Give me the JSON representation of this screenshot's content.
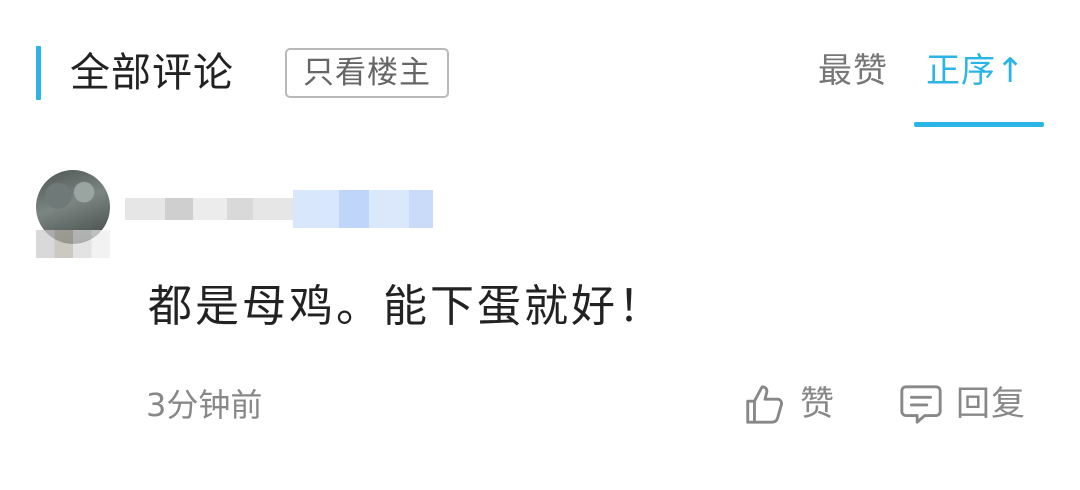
{
  "header": {
    "title": "全部评论",
    "owner_only_label": "只看楼主",
    "sort_hot_label": "最赞",
    "sort_asc_label": "正序↑",
    "accent_color": "#2bb5e6"
  },
  "comment": {
    "text": "都是母鸡。能下蛋就好！",
    "timestamp": "3分钟前",
    "like_label": "赞",
    "reply_label": "回复",
    "like_icon": "thumbs-up-icon",
    "reply_icon": "comment-bubble-icon"
  }
}
